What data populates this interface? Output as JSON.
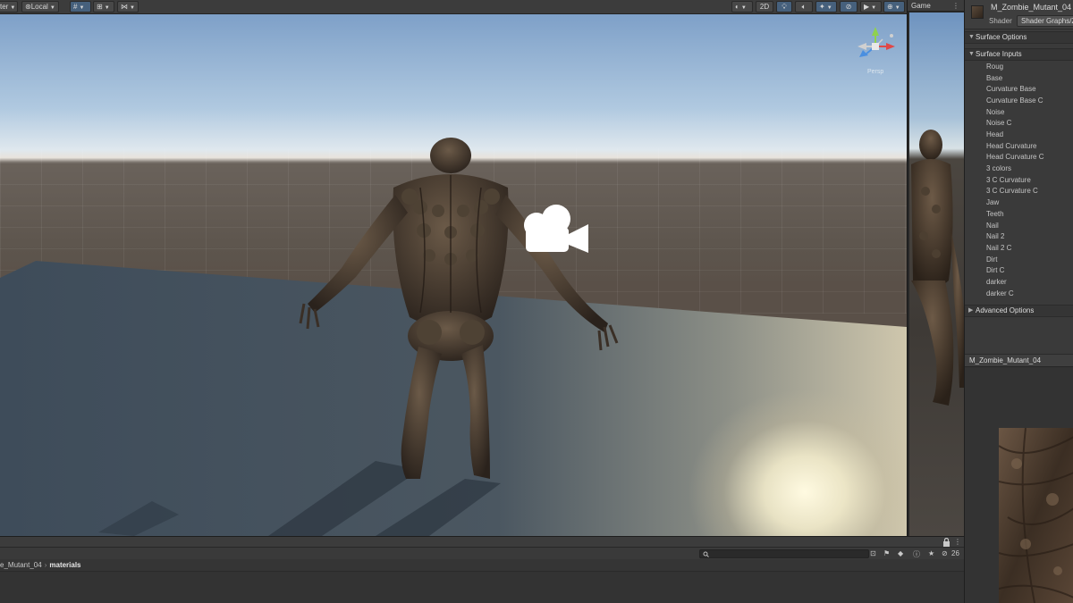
{
  "scene_toolbar": {
    "pivot_label": "ter",
    "space_label": "Local",
    "mode_2d_label": "2D"
  },
  "scene_view": {
    "camera_projection_label": "Persp"
  },
  "game_view": {
    "tab_label": "Game"
  },
  "inspector": {
    "material_name": "M_Zombie_Mutant_04",
    "shader_label": "Shader",
    "shader_value": "Shader Graphs/Z",
    "sections": {
      "surface_options": "Surface Options",
      "surface_inputs": "Surface Inputs",
      "advanced_options": "Advanced Options"
    },
    "surface_inputs": [
      "Roug",
      "Base",
      "Curvature Base",
      "Curvature Base C",
      "Noise",
      "Noise C",
      "Head",
      "Head Curvature",
      "Head Curvature C",
      "3 colors",
      "3 C Curvature",
      "3 C Curvature C",
      "Jaw",
      "Teeth",
      "Nail",
      "Nail 2",
      "Nail 2 C",
      "Dirt",
      "Dirt C",
      "darker",
      "darker C"
    ],
    "preview_title": "M_Zombie_Mutant_04"
  },
  "project": {
    "breadcrumb_parent": "e_Mutant_04",
    "breadcrumb_current": "materials",
    "hidden_packages_count": "26"
  },
  "colors": {
    "editor_bg": "#383838",
    "toolbar_bg": "#3c3c3c",
    "active_button": "#46607c",
    "gizmo_x": "#e04848",
    "gizmo_y": "#8fd14f",
    "gizmo_z": "#4a8fe0"
  },
  "icons": [
    "grid-snap-icon",
    "camera-gizmo-icon",
    "lighting-toggle-icon",
    "audio-toggle-icon",
    "effects-icon",
    "hidden-objects-icon",
    "scene-camera-icon",
    "gizmos-icon",
    "lock-icon",
    "search-icon",
    "favorite-icon"
  ]
}
